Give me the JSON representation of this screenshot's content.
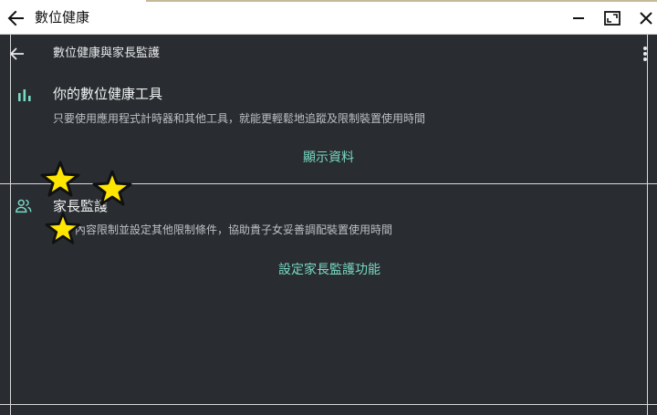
{
  "window": {
    "title": "數位健康",
    "back_icon": "arrow-left-icon",
    "controls": [
      "minimize-icon",
      "maximize-icon",
      "close-icon"
    ]
  },
  "app_bar": {
    "title": "數位健康與家長監護",
    "back_icon": "arrow-left-icon",
    "menu_icon": "more-vert-icon"
  },
  "digital_wellbeing": {
    "icon": "bar-chart-icon",
    "title": "你的數位健康工具",
    "description": "只要使用應用程式計時器和其他工具，就能更輕鬆地追蹤及限制裝置使用時間",
    "action": "顯示資料"
  },
  "parental_controls": {
    "icon": "people-icon",
    "title": "家長監護",
    "description": "內容限制並設定其他限制條件，協助貴子女妥善調配裝置使用時間",
    "action": "設定家長監護功能"
  },
  "colors": {
    "background": "#292c30",
    "accent": "#78d9c4",
    "star_fill": "#ffe600"
  }
}
